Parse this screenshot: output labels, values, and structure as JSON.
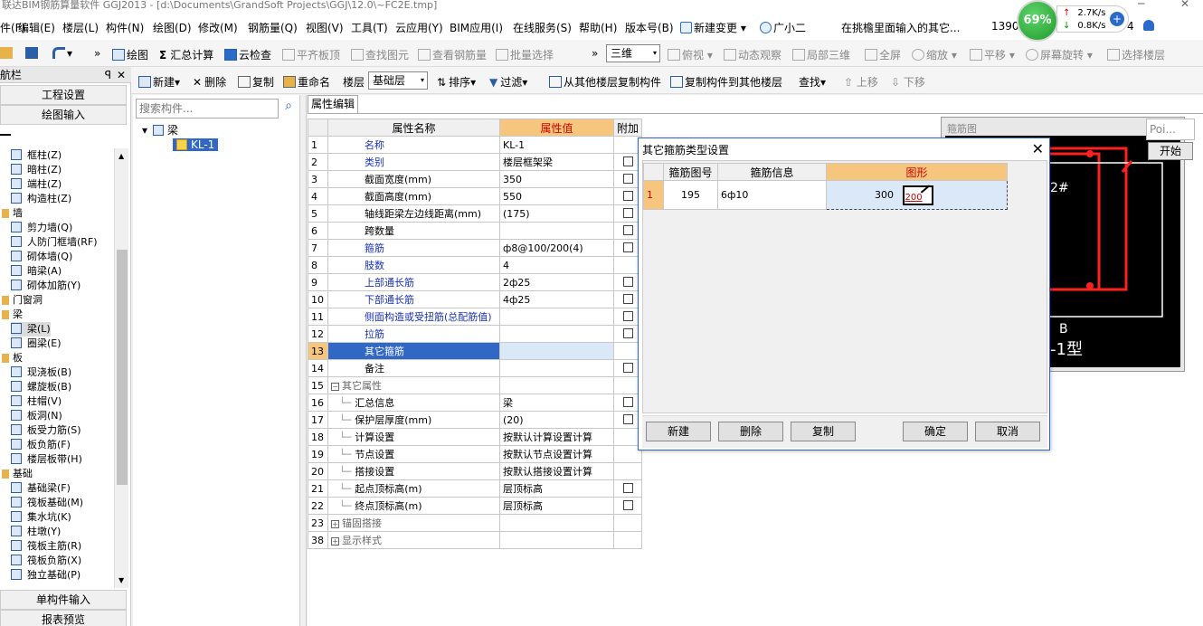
{
  "window": {
    "title": "联达BIM钢筋算量软件 GGJ2013 - [d:\\Documents\\GrandSoft Projects\\GGJ\\12.0\\~FC2E.tmp]",
    "minimize_glyph": "─",
    "close_glyph": "✕"
  },
  "menu": {
    "items": [
      "件(F)",
      "编辑(E)",
      "楼层(L)",
      "构件(N)",
      "绘图(D)",
      "修改(M)",
      "钢筋量(Q)",
      "视图(V)",
      "工具(T)",
      "云应用(Y)",
      "BIM应用(I)",
      "在线服务(S)",
      "帮助(H)",
      "版本号(B)"
    ],
    "new_change": "新建变更",
    "new_change_arrow": "▾",
    "assistant": "广小二",
    "notice": "在挑檐里面输入的其它...",
    "counter_left": "1390",
    "counter_right": "4",
    "speed_percent": "69%",
    "upload_speed": "2.7K/s",
    "download_speed": "0.8K/s",
    "up_arrow": "↑",
    "down_arrow": "↓",
    "plus_glyph": "+"
  },
  "toolbar1": {
    "undo_arrow": "▾",
    "chevron": "»",
    "draw": "绘图",
    "sum_glyph": "Σ",
    "sum_calc": "汇总计算",
    "cloud_check": "云检查",
    "level_slab": "平齐板顶",
    "find_element": "查找图元",
    "view_rebar": "查看钢筋量",
    "batch_select": "批量选择",
    "view_mode": "三维",
    "combo_arrow": "▾",
    "top_view": "俯视",
    "dyn_observe": "动态观察",
    "local_3d": "局部三维",
    "fullscreen": "全屏",
    "zoom": "缩放",
    "pan": "平移",
    "rotate": "屏幕旋转",
    "select_floor": "选择楼层"
  },
  "toolbar2": {
    "new": "新建",
    "delete": "删除",
    "copy": "复制",
    "rename": "重命名",
    "floor_label": "楼层",
    "floor_value": "基础层",
    "sort": "排序",
    "filter": "过滤",
    "copy_from_floor": "从其他楼层复制构件",
    "copy_to_floor": "复制构件到其他楼层",
    "find": "查找",
    "move_up": "上移",
    "move_down": "下移",
    "arrow": "▾",
    "up_glyph": "⇧",
    "down_glyph": "⇩"
  },
  "nav": {
    "title": "导航栏",
    "pin_glyph": "ꟼ",
    "close_glyph": "✕",
    "project_settings": "工程设置",
    "drawing_input": "绘图输入",
    "single_input": "单构件输入",
    "report_preview": "报表预览",
    "scroll_up": "▲",
    "scroll_down": "▼",
    "items": [
      {
        "label": "框柱(Z)",
        "cat": false
      },
      {
        "label": "暗柱(Z)",
        "cat": false
      },
      {
        "label": "端柱(Z)",
        "cat": false
      },
      {
        "label": "构造柱(Z)",
        "cat": false
      },
      {
        "label": "墙",
        "cat": true
      },
      {
        "label": "剪力墙(Q)",
        "cat": false
      },
      {
        "label": "人防门框墙(RF)",
        "cat": false
      },
      {
        "label": "砌体墙(Q)",
        "cat": false
      },
      {
        "label": "暗梁(A)",
        "cat": false
      },
      {
        "label": "砌体加筋(Y)",
        "cat": false
      },
      {
        "label": "门窗洞",
        "cat": true
      },
      {
        "label": "梁",
        "cat": true
      },
      {
        "label": "梁(L)",
        "cat": false,
        "sel": true
      },
      {
        "label": "圈梁(E)",
        "cat": false
      },
      {
        "label": "板",
        "cat": true
      },
      {
        "label": "现浇板(B)",
        "cat": false
      },
      {
        "label": "螺旋板(B)",
        "cat": false
      },
      {
        "label": "柱帽(V)",
        "cat": false
      },
      {
        "label": "板洞(N)",
        "cat": false
      },
      {
        "label": "板受力筋(S)",
        "cat": false
      },
      {
        "label": "板负筋(F)",
        "cat": false
      },
      {
        "label": "楼层板带(H)",
        "cat": false
      },
      {
        "label": "基础",
        "cat": true
      },
      {
        "label": "基础梁(F)",
        "cat": false
      },
      {
        "label": "筏板基础(M)",
        "cat": false
      },
      {
        "label": "集水坑(K)",
        "cat": false
      },
      {
        "label": "柱墩(Y)",
        "cat": false
      },
      {
        "label": "筏板主筋(R)",
        "cat": false
      },
      {
        "label": "筏板负筋(X)",
        "cat": false
      },
      {
        "label": "独立基础(P)",
        "cat": false
      }
    ]
  },
  "tree": {
    "search_placeholder": "搜索构件...",
    "search_glyph": "⌕",
    "root": "梁",
    "child": "KL-1",
    "expand_glyph": "▾"
  },
  "props": {
    "tab": "属性编辑",
    "headers": {
      "name": "属性名称",
      "value": "属性值",
      "add": "附加"
    },
    "expand_minus": "−",
    "expand_plus": "+",
    "rows": [
      {
        "idx": "1",
        "name": "名称",
        "value": "KL-1",
        "cb": false,
        "style": "blue"
      },
      {
        "idx": "2",
        "name": "类别",
        "value": "楼层框架梁",
        "cb": true,
        "style": "blue"
      },
      {
        "idx": "3",
        "name": "截面宽度(mm)",
        "value": "350",
        "cb": true,
        "style": ""
      },
      {
        "idx": "4",
        "name": "截面高度(mm)",
        "value": "550",
        "cb": true,
        "style": ""
      },
      {
        "idx": "5",
        "name": "轴线距梁左边线距离(mm)",
        "value": "(175)",
        "cb": true,
        "style": ""
      },
      {
        "idx": "6",
        "name": "跨数量",
        "value": "",
        "cb": true,
        "style": ""
      },
      {
        "idx": "7",
        "name": "箍筋",
        "value": "ф8@100/200(4)",
        "cb": true,
        "style": "blue"
      },
      {
        "idx": "8",
        "name": "肢数",
        "value": "4",
        "cb": false,
        "style": "blue"
      },
      {
        "idx": "9",
        "name": "上部通长筋",
        "value": "2ф25",
        "cb": true,
        "style": "blue"
      },
      {
        "idx": "10",
        "name": "下部通长筋",
        "value": "4ф25",
        "cb": true,
        "style": "blue"
      },
      {
        "idx": "11",
        "name": "侧面构造或受扭筋(总配筋值)",
        "value": "",
        "cb": true,
        "style": "blue"
      },
      {
        "idx": "12",
        "name": "拉筋",
        "value": "",
        "cb": true,
        "style": "blue"
      },
      {
        "idx": "13",
        "name": "其它箍筋",
        "value": "",
        "cb": false,
        "style": "hl"
      },
      {
        "idx": "14",
        "name": "备注",
        "value": "",
        "cb": true,
        "style": ""
      },
      {
        "idx": "15",
        "name": "其它属性",
        "value": "",
        "cb": false,
        "style": "grey",
        "group": "minus"
      },
      {
        "idx": "16",
        "name": "汇总信息",
        "value": "梁",
        "cb": true,
        "style": "",
        "child": true
      },
      {
        "idx": "17",
        "name": "保护层厚度(mm)",
        "value": "(20)",
        "cb": true,
        "style": "",
        "child": true
      },
      {
        "idx": "18",
        "name": "计算设置",
        "value": "按默认计算设置计算",
        "cb": false,
        "style": "",
        "child": true
      },
      {
        "idx": "19",
        "name": "节点设置",
        "value": "按默认节点设置计算",
        "cb": false,
        "style": "",
        "child": true
      },
      {
        "idx": "20",
        "name": "搭接设置",
        "value": "按默认搭接设置计算",
        "cb": false,
        "style": "",
        "child": true
      },
      {
        "idx": "21",
        "name": "起点顶标高(m)",
        "value": "层顶标高",
        "cb": true,
        "style": "",
        "child": true
      },
      {
        "idx": "22",
        "name": "终点顶标高(m)",
        "value": "层顶标高",
        "cb": true,
        "style": "",
        "child": true
      },
      {
        "idx": "23",
        "name": "锚固搭接",
        "value": "",
        "cb": false,
        "style": "grey",
        "group": "plus"
      },
      {
        "idx": "38",
        "name": "显示样式",
        "value": "",
        "cb": false,
        "style": "grey",
        "group": "plus"
      }
    ]
  },
  "preview": {
    "title": "箍筋图",
    "label_2": "2#",
    "label_b": "B",
    "label_type": "-1型",
    "poi_input": "Poi...",
    "start_button": "开始"
  },
  "dialog": {
    "title": "其它箍筋类型设置",
    "close_glyph": "✕",
    "headers": {
      "no": "箍筋图号",
      "info": "箍筋信息",
      "shape": "图形"
    },
    "row": {
      "idx": "1",
      "no": "195",
      "info": "6ф10",
      "dim_a": "300",
      "dim_b": "200"
    },
    "buttons": {
      "new": "新建",
      "delete": "删除",
      "copy": "复制",
      "ok": "确定",
      "cancel": "取消"
    }
  }
}
